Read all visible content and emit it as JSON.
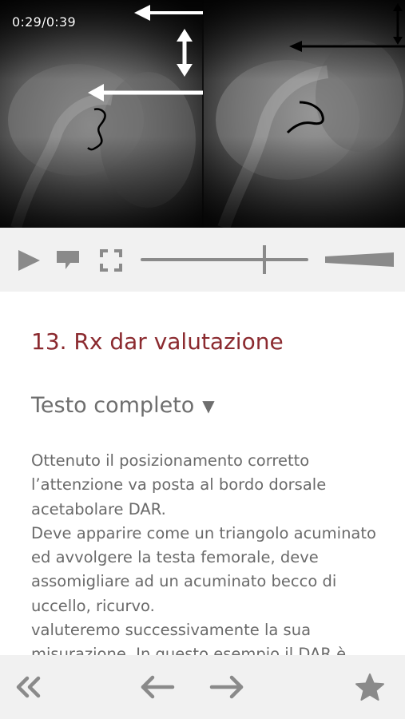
{
  "player": {
    "timecode": "0:29/0:39",
    "progress_fraction": 0.74,
    "icons": {
      "play": "play-icon",
      "comment": "comment-icon",
      "fullscreen": "fullscreen-icon",
      "volume": "volume-icon"
    }
  },
  "lesson": {
    "title": "13. Rx dar valutazione",
    "section_label": "Testo completo",
    "section_caret": "▼",
    "paragraphs": [
      "Ottenuto il posizionamento corretto l’attenzione va posta al bordo dorsale acetabolare DAR.",
      "Deve apparire come un triangolo acuminato ed avvolgere la testa femorale, deve assomigliare ad un acuminato becco di uccello, ricurvo.",
      "valuteremo successivamente la sua misurazione. In questo esempio il DAR è"
    ]
  },
  "bottom_nav": {
    "icons": [
      "rewind-icon",
      "arrow-left-icon",
      "arrow-right-icon",
      "star-icon"
    ]
  },
  "colors": {
    "title_accent": "#8b2a2f",
    "bar_background": "#f1f1f1",
    "icon_gray": "#8a8a8a",
    "text_gray": "#6a6a6a"
  }
}
